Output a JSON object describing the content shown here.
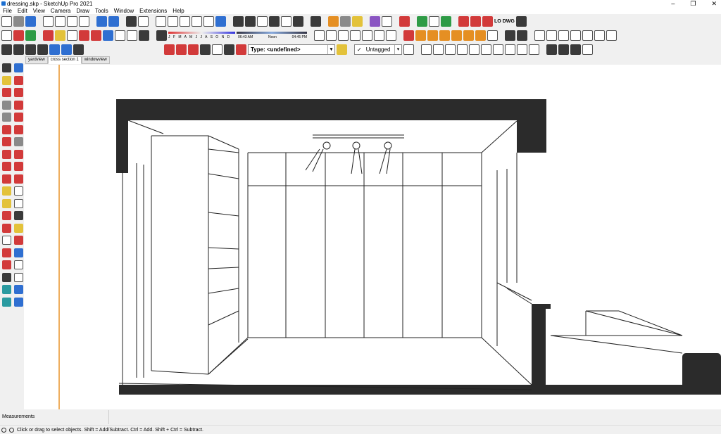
{
  "window": {
    "title": "dressing.skp - SketchUp Pro 2021",
    "controls": [
      "–",
      "❐",
      "✕"
    ]
  },
  "menu": [
    "File",
    "Edit",
    "View",
    "Camera",
    "Draw",
    "Tools",
    "Window",
    "Extensions",
    "Help"
  ],
  "toolbar": {
    "shadow_months": "J F M A M J J A S O N D",
    "time_start": "06:43 AM",
    "time_noon": "Noon",
    "time_end": "04:45 PM",
    "lo_label": "LO",
    "dwg_label": "DWG",
    "type_dropdown": "Type: <undefined>",
    "tag_dropdown": "Untagged",
    "tag_check": "✓"
  },
  "scene_tabs": [
    "yardview",
    "cross section 1",
    "windowview"
  ],
  "active_scene": "cross section 1",
  "measurements_label": "Measurements",
  "status_text": "Click or drag to select objects. Shift = Add/Subtract. Ctrl = Add. Shift + Ctrl = Subtract.",
  "colors": {
    "section_fill": "#2b2b2b",
    "axis_orange": "#e8942a"
  }
}
